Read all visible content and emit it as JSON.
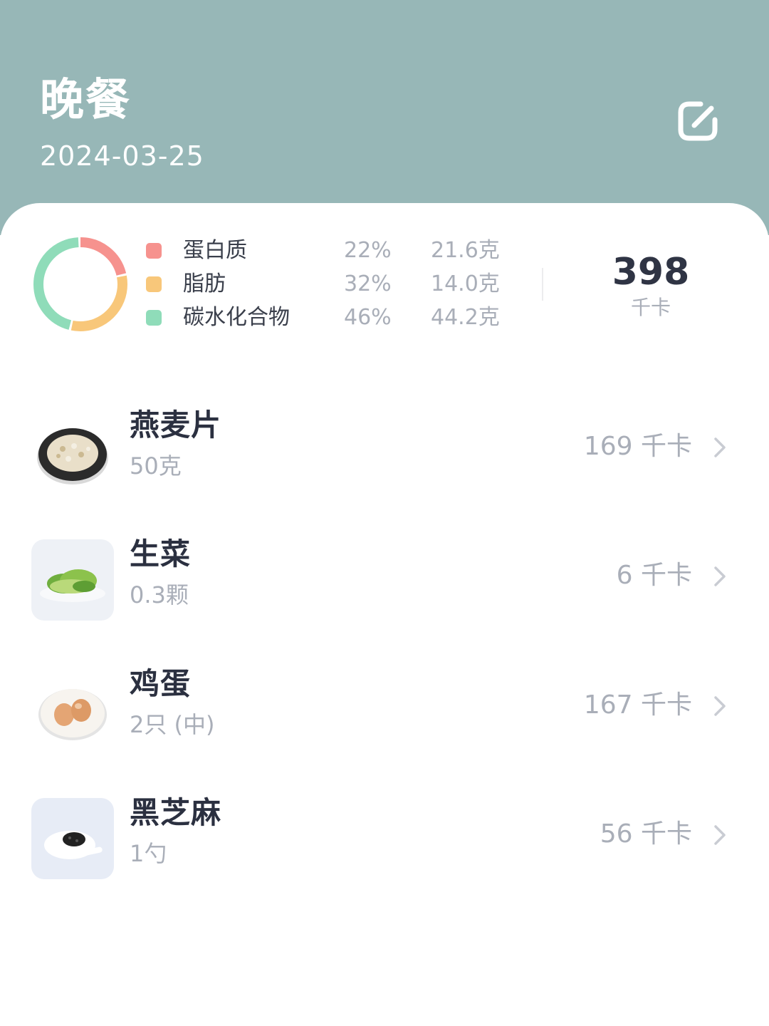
{
  "header": {
    "title": "晚餐",
    "date": "2024-03-25",
    "edit_icon": "edit-icon",
    "background_color": "#97b7b7"
  },
  "nutrition": {
    "macros": [
      {
        "name": "蛋白质",
        "percent": "22%",
        "grams": "21.6克",
        "color": "#f6928e",
        "fraction": 0.22
      },
      {
        "name": "脂肪",
        "percent": "32%",
        "grams": "14.0克",
        "color": "#f8c77a",
        "fraction": 0.32
      },
      {
        "name": "碳水化合物",
        "percent": "46%",
        "grams": "44.2克",
        "color": "#8fdcb9",
        "fraction": 0.46
      }
    ],
    "total_kcal": "398",
    "total_unit": "千卡"
  },
  "foods": [
    {
      "name": "燕麦片",
      "amount": "50克",
      "kcal": "169 千卡",
      "image": "oatmeal-image"
    },
    {
      "name": "生菜",
      "amount": "0.3颗",
      "kcal": "6 千卡",
      "image": "lettuce-image"
    },
    {
      "name": "鸡蛋",
      "amount": "2只 (中)",
      "kcal": "167 千卡",
      "image": "eggs-image"
    },
    {
      "name": "黑芝麻",
      "amount": "1勺",
      "kcal": "56 千卡",
      "image": "black-sesame-image"
    }
  ]
}
